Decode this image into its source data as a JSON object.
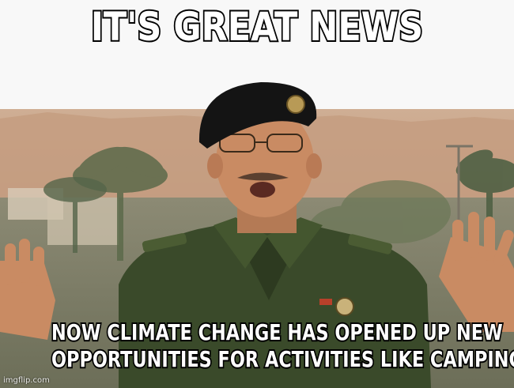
{
  "meme": {
    "top_text": "IT'S GREAT NEWS",
    "bottom_line_1": "NOW CLIMATE CHANGE HAS OPENED UP NEW",
    "bottom_line_2": "OPPORTUNITIES FOR ACTIVITIES LIKE CAMPING!",
    "watermark": "imgflip.com"
  },
  "colors": {
    "caption_fill": "#ffffff",
    "caption_stroke": "#000000",
    "sky": "#c9a58a",
    "uniform": "#3b4a2a",
    "beret": "#141414",
    "skin": "#c98b63"
  }
}
